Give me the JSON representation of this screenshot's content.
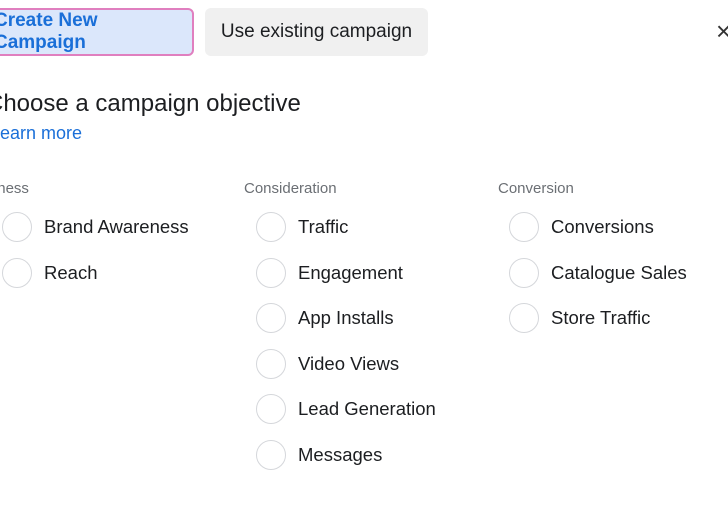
{
  "tabs": {
    "create_new": "Create New Campaign",
    "use_existing": "Use existing campaign"
  },
  "close_icon": "×",
  "heading": "Choose a campaign objective",
  "learn_more": "Learn more",
  "columns": [
    {
      "title": "Awareness",
      "options": [
        "Brand Awareness",
        "Reach"
      ]
    },
    {
      "title": "Consideration",
      "options": [
        "Traffic",
        "Engagement",
        "App Installs",
        "Video Views",
        "Lead Generation",
        "Messages"
      ]
    },
    {
      "title": "Conversion",
      "options": [
        "Conversions",
        "Catalogue Sales",
        "Store Traffic"
      ]
    }
  ]
}
